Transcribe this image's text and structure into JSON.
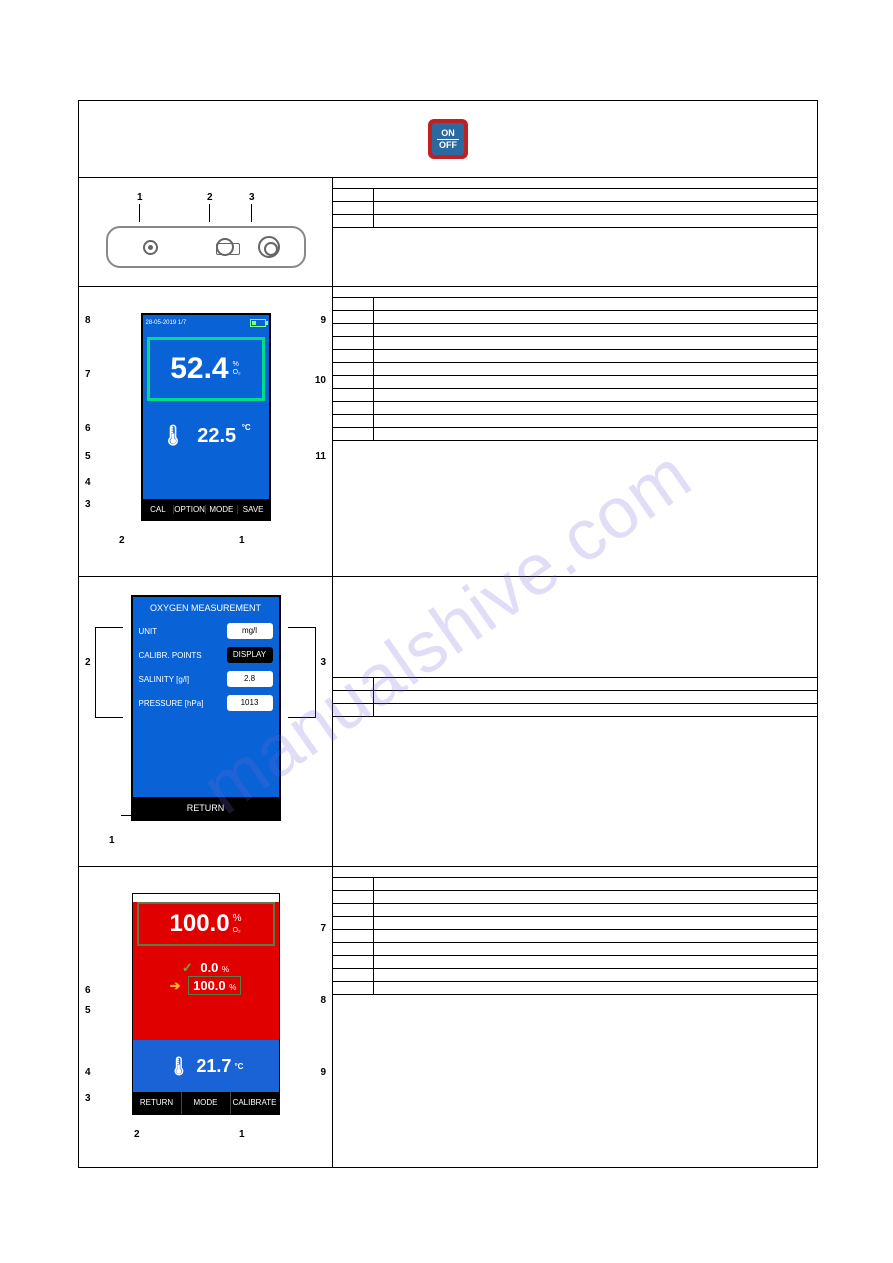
{
  "header": {
    "button_on": "ON",
    "button_off": "OFF"
  },
  "row1": {
    "labels": {
      "n1": "1",
      "n2": "2",
      "n3": "3"
    },
    "table": [
      {
        "n": "",
        "desc": ""
      },
      {
        "n": "",
        "desc": ""
      },
      {
        "n": "",
        "desc": ""
      }
    ]
  },
  "row2": {
    "labels": {
      "n1": "1",
      "n2": "2",
      "n3": "3",
      "n4": "4",
      "n5": "5",
      "n6": "6",
      "n7": "7",
      "n8": "8",
      "n9": "9",
      "n10": "10",
      "n11": "11"
    },
    "screen": {
      "date": "28-05-2019   1/7",
      "main_value": "52.4",
      "main_unit_top": "%",
      "main_unit_bot": "O₂",
      "temp_value": "22.5",
      "temp_unit": "°C",
      "buttons": {
        "b1": "CAL",
        "b2": "OPTION",
        "b3": "MODE",
        "b4": "SAVE"
      }
    },
    "table_rows": 11
  },
  "row3": {
    "labels": {
      "n1": "1",
      "n2": "2",
      "n3": "3"
    },
    "screen": {
      "title": "OXYGEN MEASUREMENT",
      "items": [
        {
          "label": "UNIT",
          "value": "mg/l",
          "style": "white"
        },
        {
          "label": "CALIBR.  POINTS",
          "value": "DISPLAY",
          "style": "black"
        },
        {
          "label": "SALINITY   [g/l]",
          "value": "2.8",
          "style": "white"
        },
        {
          "label": "PRESSURE  [hPa]",
          "value": "1013",
          "style": "white"
        }
      ],
      "return": "RETURN"
    },
    "table_rows": 3
  },
  "row4": {
    "labels": {
      "n1": "1",
      "n2": "2",
      "n3": "3",
      "n4": "4",
      "n5": "5",
      "n6": "6",
      "n7": "7",
      "n8": "8",
      "n9": "9"
    },
    "screen": {
      "top_value": "100.0",
      "top_unit": "% O₂",
      "mid_value1": "0.0",
      "mid_unit1": "%",
      "mid_value2": "100.0",
      "mid_unit2": "%",
      "temp_value": "21.7",
      "temp_unit": "°C",
      "buttons": {
        "b1": "RETURN",
        "b2": "MODE",
        "b3": "CALIBRATE"
      }
    },
    "table_rows": 9
  },
  "watermark": "manualshive.com"
}
